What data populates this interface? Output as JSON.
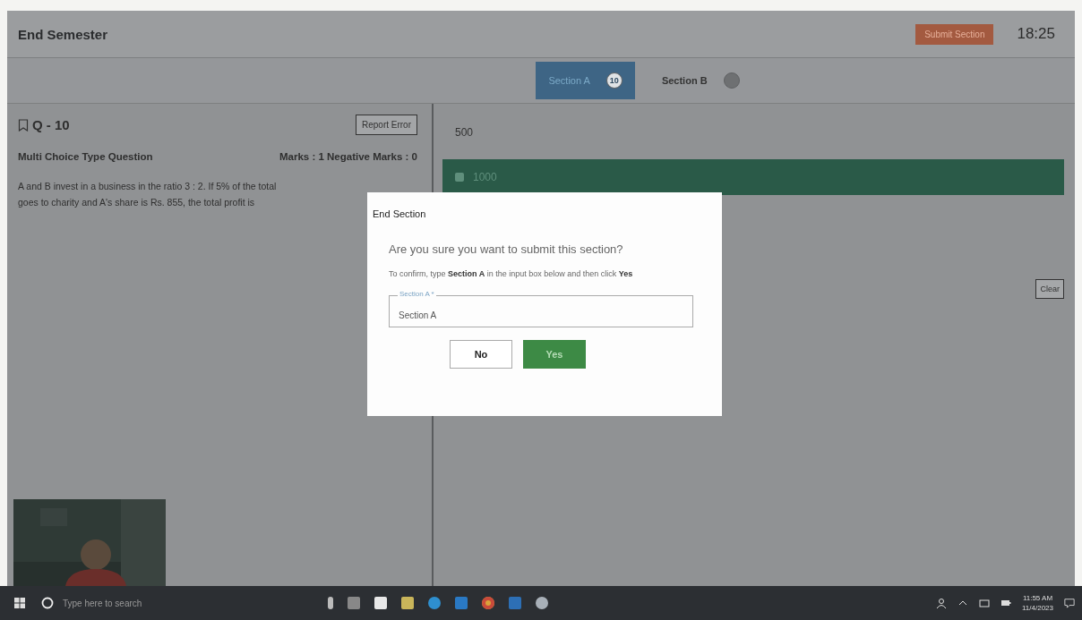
{
  "header": {
    "title": "End Semester",
    "submit_button": "Submit Section",
    "timer": "18:25"
  },
  "sections": [
    {
      "label": "Section A",
      "count": "10",
      "selected": true
    },
    {
      "label": "Section B",
      "selected": false
    }
  ],
  "question": {
    "number": "Q - 10",
    "report_button": "Report Error",
    "type": "Multi Choice Type Question",
    "marks": "Marks : 1 Negative Marks : 0",
    "lines": [
      "A and B invest in a business in the ratio 3 : 2. If 5% of the total",
      "goes to charity and A's share is Rs. 855, the total profit is"
    ]
  },
  "options": [
    {
      "label": "500",
      "selected": false
    },
    {
      "label": "1000",
      "selected": true
    }
  ],
  "clear_button": "Clear",
  "dialog": {
    "title": "End Section",
    "question": "Are you sure you want to submit this section?",
    "instruction": "To confirm, type **Section A** in the input box below and then click **Yes**",
    "field_label": "Section A *",
    "field_value": "Section A",
    "buttons": [
      {
        "label": "No",
        "kind": "secondary"
      },
      {
        "label": "Yes",
        "kind": "primary"
      }
    ]
  },
  "taskbar": {
    "search_placeholder": "Type here to search",
    "time": "11:55 AM",
    "date": "11/4/2023"
  }
}
